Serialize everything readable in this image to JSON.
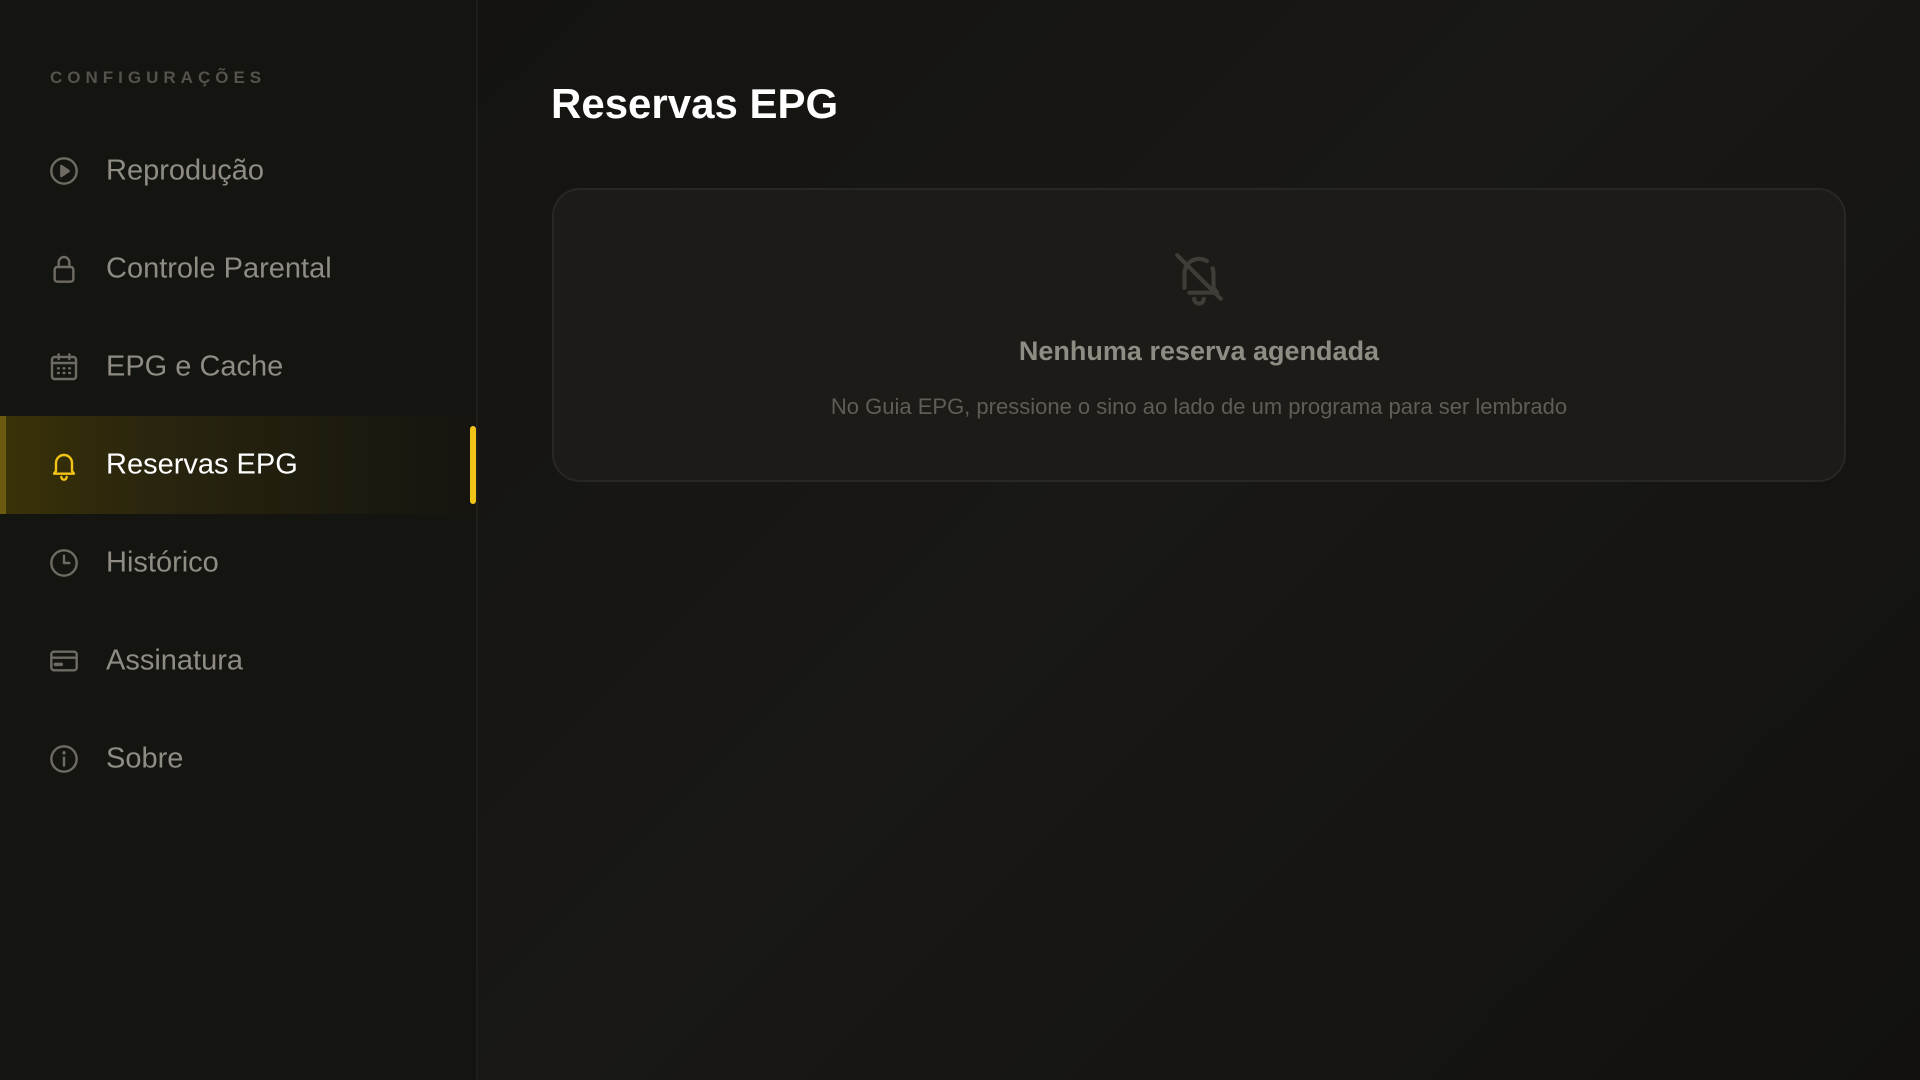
{
  "sidebar": {
    "heading": "CONFIGURAÇÕES",
    "items": [
      {
        "label": "Reprodução",
        "icon": "play-circle-icon"
      },
      {
        "label": "Controle Parental",
        "icon": "lock-icon"
      },
      {
        "label": "EPG e Cache",
        "icon": "calendar-icon"
      },
      {
        "label": "Reservas EPG",
        "icon": "bell-icon",
        "active": true
      },
      {
        "label": "Histórico",
        "icon": "clock-icon"
      },
      {
        "label": "Assinatura",
        "icon": "credit-card-icon"
      },
      {
        "label": "Sobre",
        "icon": "info-icon"
      }
    ]
  },
  "main": {
    "title": "Reservas EPG",
    "empty_state": {
      "icon": "bell-off-icon",
      "title": "Nenhuma reserva agendada",
      "description": "No Guia EPG, pressione o sino ao lado de um programa para ser lembrado"
    }
  },
  "colors": {
    "accent": "#f2c417",
    "background": "#121110",
    "text_primary": "#ffffff",
    "text_muted": "#8f8c84"
  }
}
